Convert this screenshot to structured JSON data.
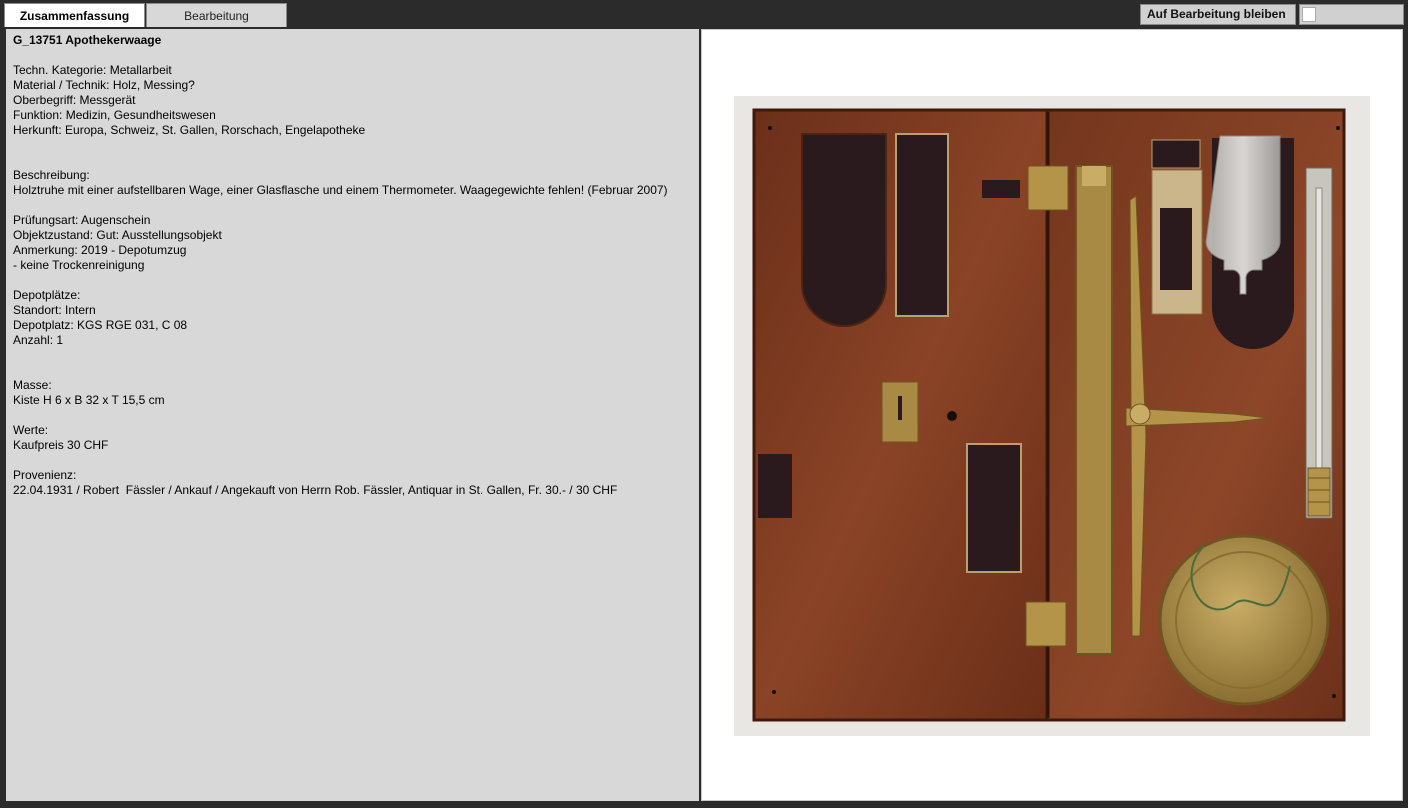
{
  "tabs": {
    "summary_label": "Zusammenfassung",
    "edit_label": "Bearbeitung"
  },
  "stay_button_label": "Auf Bearbeitung bleiben",
  "record": {
    "title": "G_13751 Apothekerwaage",
    "category": "Techn. Kategorie: Metallarbeit",
    "material": "Material / Technik: Holz, Messing?",
    "term": "Oberbegriff: Messgerät",
    "function": "Funktion: Medizin, Gesundheitswesen",
    "origin": "Herkunft: Europa, Schweiz, St. Gallen, Rorschach, Engelapotheke",
    "desc_label": "Beschreibung:",
    "desc_text": "Holztruhe mit einer aufstellbaren Wage, einer Glasflasche und einem Thermometer. Waagegewichte fehlen! (Februar 2007)",
    "exam": "Prüfungsart: Augenschein",
    "condition": "Objektzustand: Gut: Ausstellungsobjekt",
    "remark": "Anmerkung: 2019 - Depotumzug",
    "remark2": "- keine Trockenreinigung",
    "depot_label": "Depotplätze:",
    "location": "Standort: Intern",
    "depot_place": "Depotplatz: KGS RGE 031, C 08",
    "count": "Anzahl: 1",
    "measure_label": "Masse:",
    "measure_value": "Kiste H 6 x B 32 x T 15,5 cm",
    "values_label": "Werte:",
    "values_value": "Kaufpreis 30 CHF",
    "prov_label": "Provenienz:",
    "prov_value": "22.04.1931 / Robert  Fässler / Ankauf / Angekauft von Herrn Rob. Fässler, Antiquar in St. Gallen, Fr. 30.- / 30 CHF"
  },
  "colors": {
    "wood": "#7a3a22",
    "wood_dark": "#5e2a17",
    "velvet": "#2a1a1e",
    "brass": "#a88a45",
    "brass_light": "#c9ad66"
  }
}
